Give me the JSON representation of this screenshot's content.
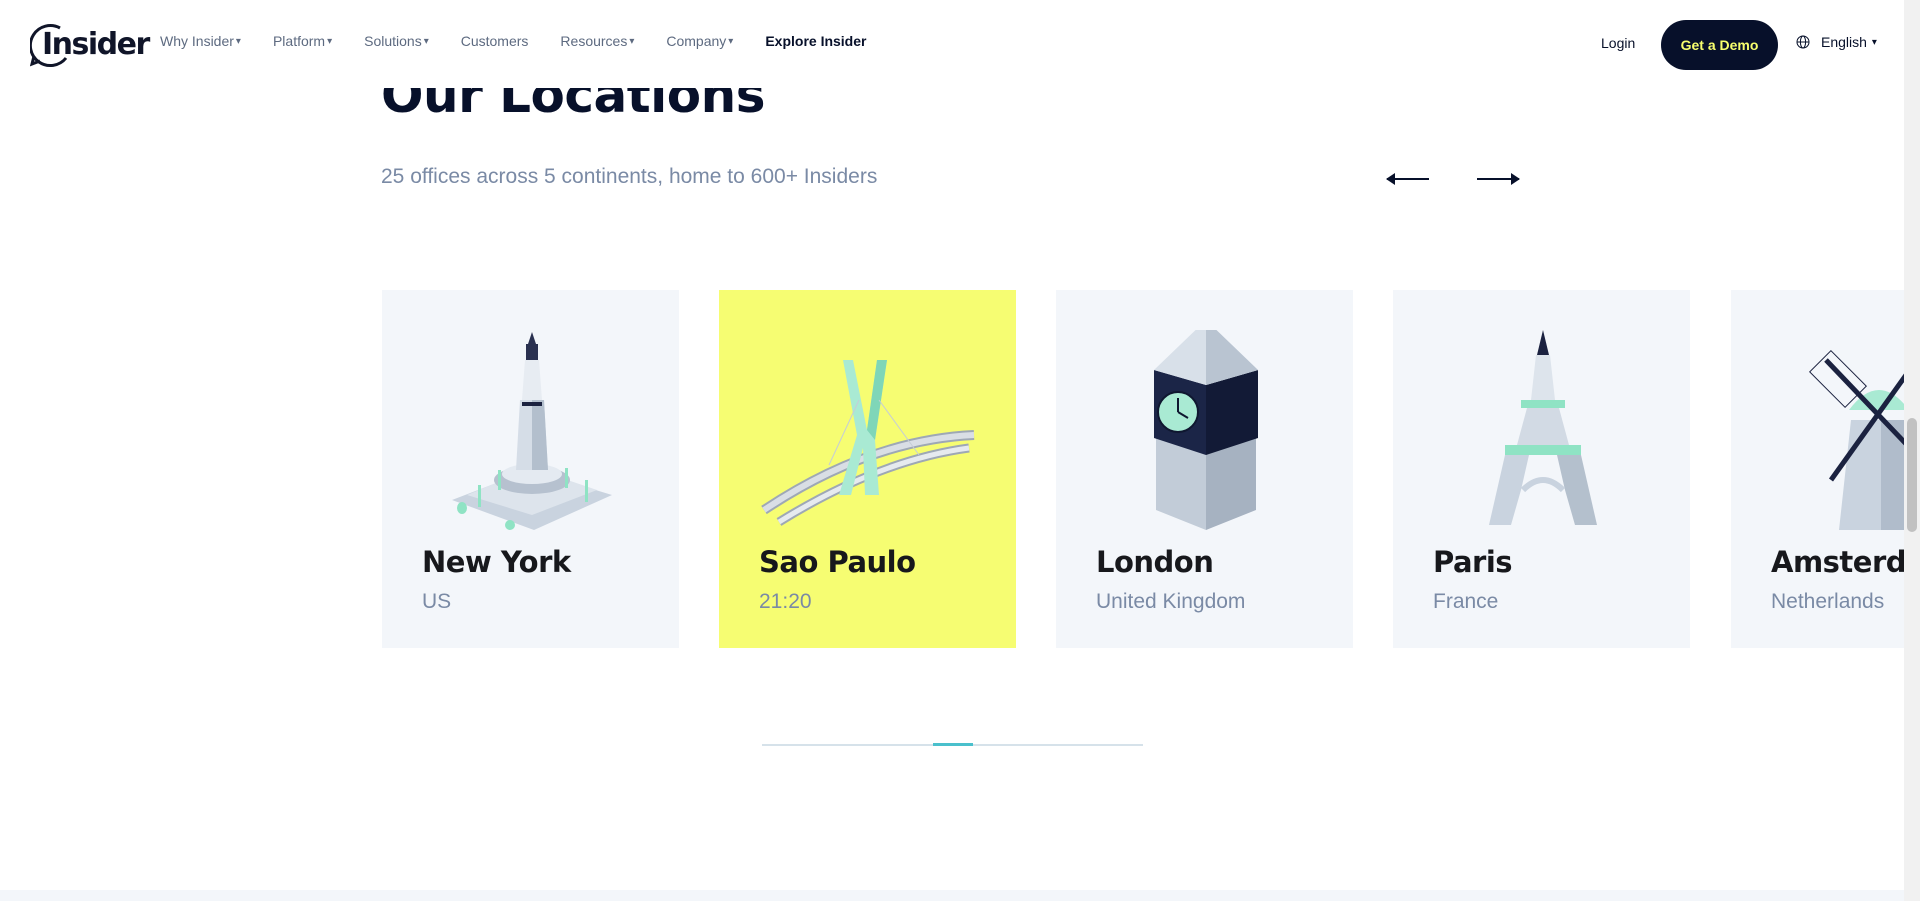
{
  "header": {
    "logo_text": "Insider",
    "nav": [
      {
        "label": "Why Insider",
        "has_caret": true
      },
      {
        "label": "Platform",
        "has_caret": true
      },
      {
        "label": "Solutions",
        "has_caret": true
      },
      {
        "label": "Customers",
        "has_caret": false
      },
      {
        "label": "Resources",
        "has_caret": true
      },
      {
        "label": "Company",
        "has_caret": true
      },
      {
        "label": "Explore Insider",
        "has_caret": false
      }
    ],
    "caret_glyph": "▾",
    "login_label": "Login",
    "demo_label": "Get a Demo",
    "language_label": "English",
    "language_caret": "▾"
  },
  "section": {
    "title": "Our Locations",
    "subtitle": "25 offices across 5 continents, home to 600+ Insiders",
    "prev_icon": "arrow-left-icon",
    "next_icon": "arrow-right-icon"
  },
  "cards": [
    {
      "city": "New York",
      "detail": "US",
      "icon": "statue-of-liberty-icon",
      "active": false
    },
    {
      "city": "Sao Paulo",
      "detail": "21:20",
      "icon": "bridge-icon",
      "active": true
    },
    {
      "city": "London",
      "detail": "United Kingdom",
      "icon": "clock-tower-icon",
      "active": false
    },
    {
      "city": "Paris",
      "detail": "France",
      "icon": "eiffel-tower-icon",
      "active": false
    },
    {
      "city": "Amsterdam",
      "detail": "Netherlands",
      "icon": "windmill-icon",
      "active": false
    }
  ],
  "carousel": {
    "progress_fraction": 0.45
  },
  "colors": {
    "navy": "#07102a",
    "accent_yellow": "#f6fd72",
    "card_bg": "#f3f6fa",
    "muted_text": "#7a8aa5",
    "progress_fill": "#4ac0cc"
  }
}
